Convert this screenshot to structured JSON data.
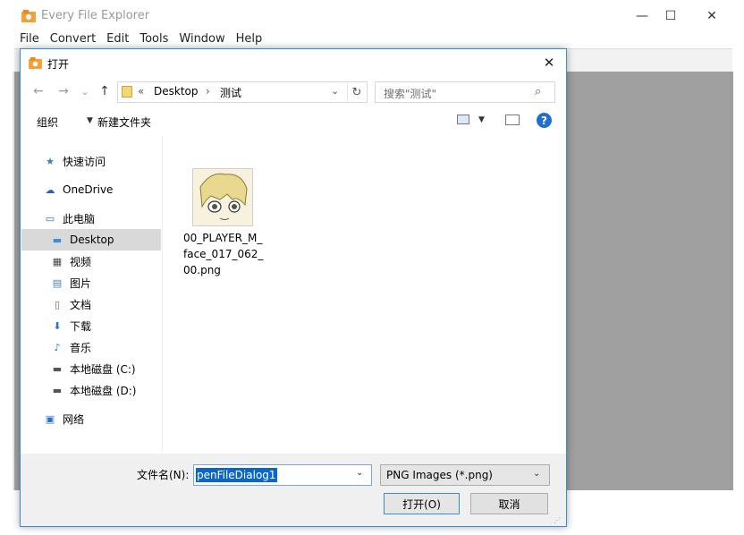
{
  "window": {
    "title": "Every File Explorer",
    "controls": {
      "minimize": "—",
      "maximize": "☐",
      "close": "✕"
    }
  },
  "menu": [
    "File",
    "Convert",
    "Edit",
    "Tools",
    "Window",
    "Help"
  ],
  "dialog": {
    "title": "打开",
    "close": "✕",
    "nav": {
      "back": "←",
      "forward": "→",
      "recent": "⌄",
      "up": "↑"
    },
    "address": {
      "sep": "«",
      "path": [
        "Desktop",
        "测试"
      ],
      "arrow": "›",
      "dropdown": "⌄",
      "refresh": "↻"
    },
    "search": {
      "placeholder": "搜索\"测试\"",
      "icon": "⌕"
    },
    "commands": {
      "organize": "组织",
      "organize_arrow": "▼",
      "new_folder": "新建文件夹",
      "view_arrow": "▼",
      "help": "?"
    },
    "nav_pane": [
      {
        "label": "快速访问",
        "icon": "star-icon",
        "glyph": "★",
        "color": "#3a78c9"
      },
      {
        "label": "OneDrive",
        "icon": "cloud-icon",
        "glyph": "☁",
        "color": "#2a62b8"
      },
      {
        "label": "此电脑",
        "icon": "computer-icon",
        "glyph": "▭",
        "color": "#2f6fbf"
      },
      {
        "label": "Desktop",
        "icon": "desktop-icon",
        "glyph": "▬",
        "color": "#3b8ede",
        "selected": true
      },
      {
        "label": "视频",
        "icon": "video-icon",
        "glyph": "▦",
        "color": "#444"
      },
      {
        "label": "图片",
        "icon": "pictures-icon",
        "glyph": "▤",
        "color": "#4a7fb5"
      },
      {
        "label": "文档",
        "icon": "document-icon",
        "glyph": "▯",
        "color": "#666"
      },
      {
        "label": "下载",
        "icon": "download-icon",
        "glyph": "⬇",
        "color": "#2d6fd0"
      },
      {
        "label": "音乐",
        "icon": "music-icon",
        "glyph": "♪",
        "color": "#2d6fd0"
      },
      {
        "label": "本地磁盘 (C:)",
        "icon": "drive-c-icon",
        "glyph": "▬",
        "color": "#555"
      },
      {
        "label": "本地磁盘 (D:)",
        "icon": "drive-d-icon",
        "glyph": "▬",
        "color": "#555"
      },
      {
        "label": "网络",
        "icon": "network-icon",
        "glyph": "▣",
        "color": "#2d6fd0"
      }
    ],
    "file": {
      "name": "00_PLAYER_M_face_017_062_00.png"
    },
    "bottom": {
      "filename_label": "文件名(N):",
      "filename_value": "penFileDialog1",
      "dropdown": "⌄",
      "filetype": "PNG Images (*.png)",
      "open": "打开(O)",
      "cancel": "取消"
    }
  }
}
